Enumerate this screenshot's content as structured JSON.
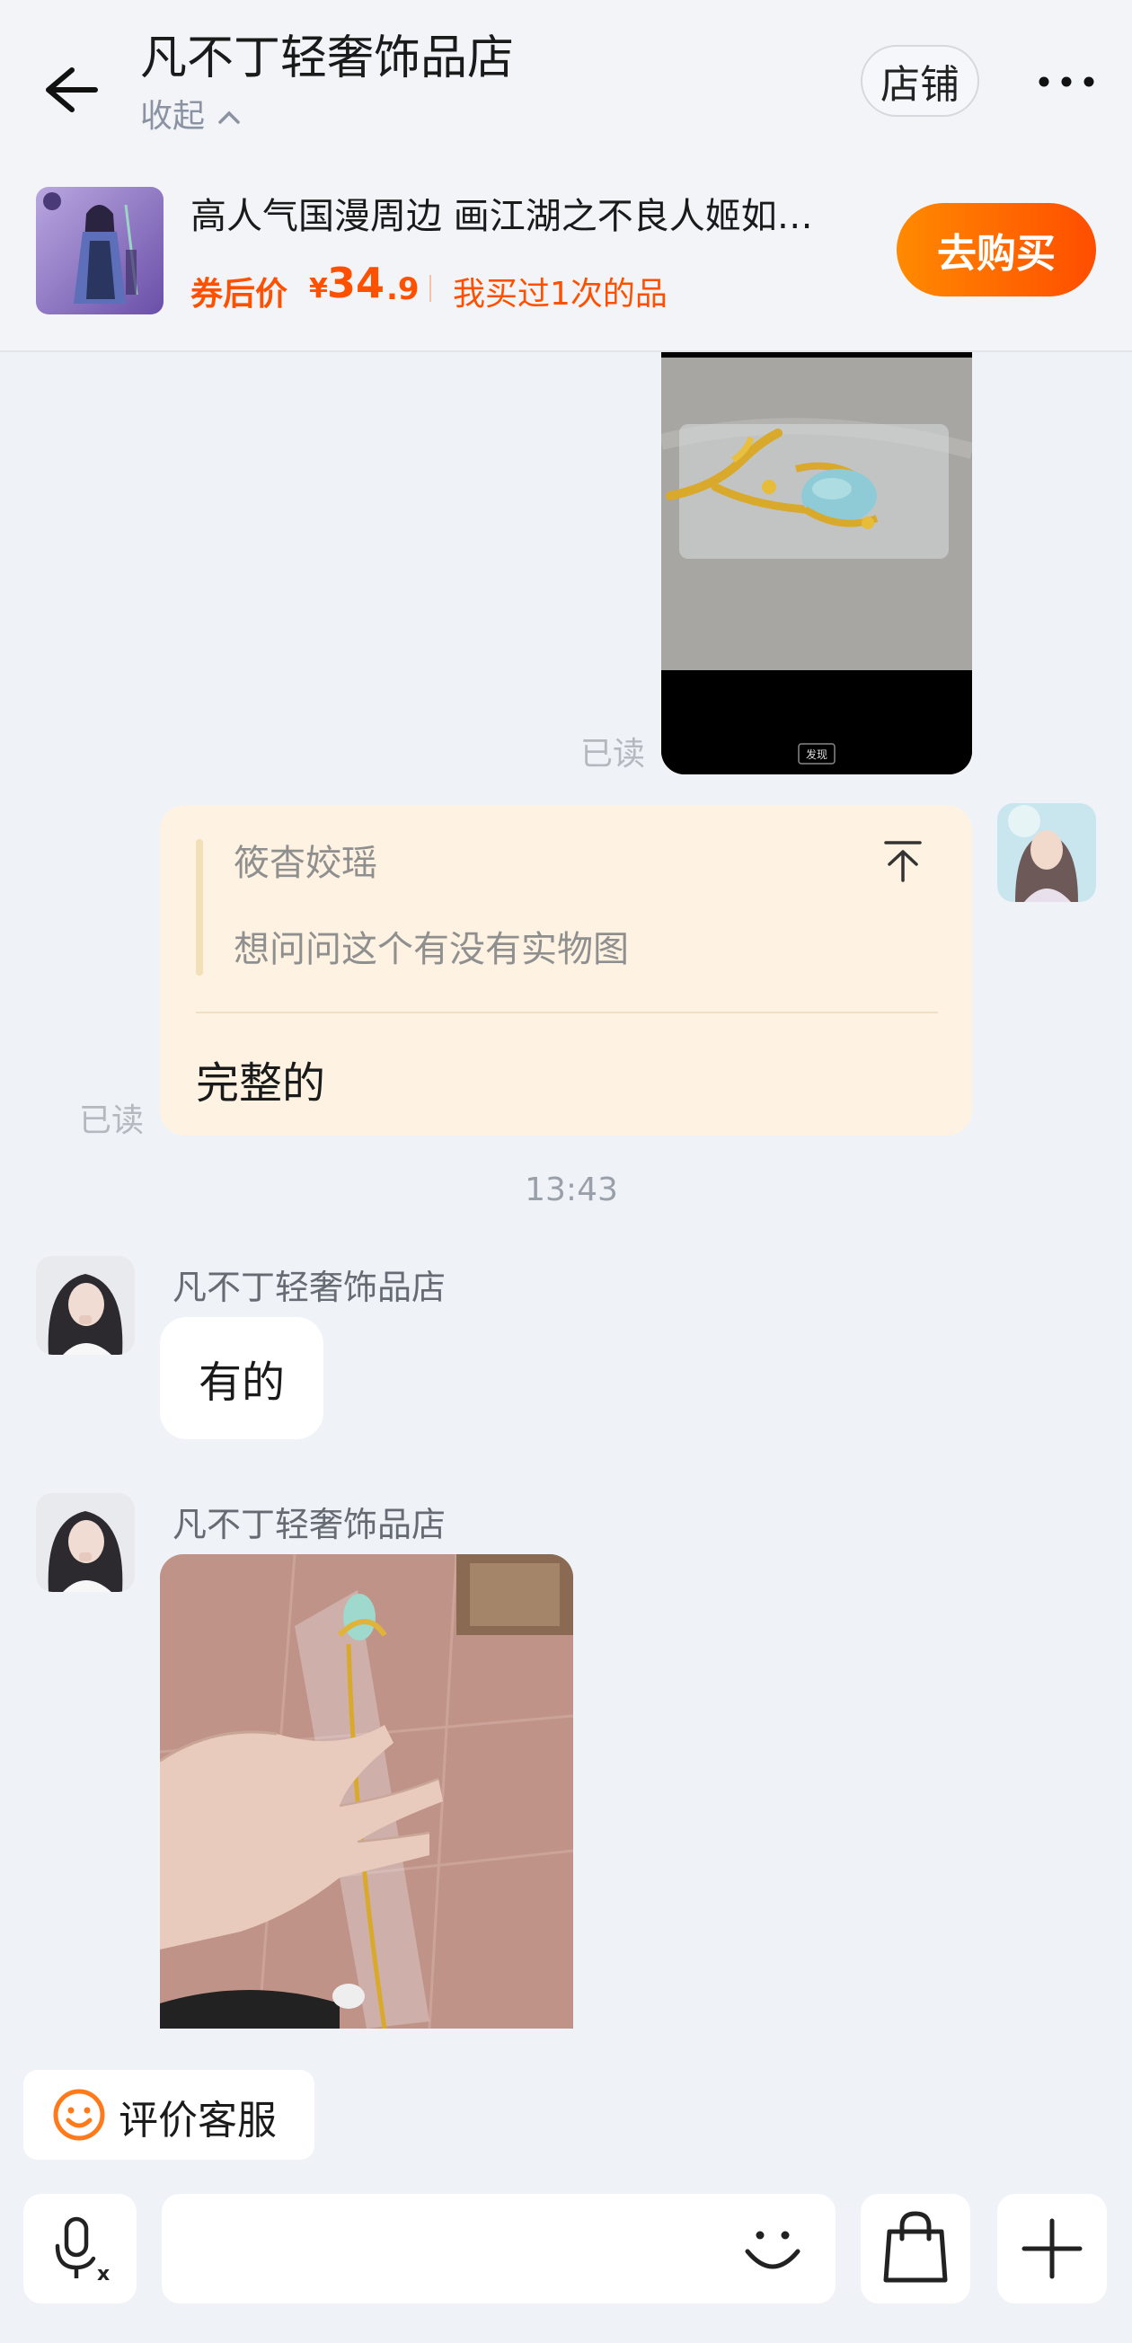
{
  "header": {
    "title": "凡不丁轻奢饰品店",
    "collapse_label": "收起",
    "shop_label": "店铺"
  },
  "product": {
    "title": "高人气国漫周边 画江湖之不良人姬如…",
    "price_label": "券后价",
    "currency": "¥",
    "price_int": "34",
    "price_dec": ".9",
    "bought_note": "我买过1次的品",
    "buy_label": "去购买"
  },
  "chat": {
    "read_label_1": "已读",
    "image_caption": "发现",
    "quote_name": "筱杳姣瑶",
    "quote_text": "想问问这个有没有实物图",
    "quote_reply": "完整的",
    "read_label_2": "已读",
    "timestamp": "13:43",
    "sender_1": "凡不丁轻奢饰品店",
    "reply_text": "有的",
    "sender_2": "凡不丁轻奢饰品店"
  },
  "bottom": {
    "rate_label": "评价客服",
    "input_placeholder": ""
  },
  "colors": {
    "accent": "#ff5000",
    "buy_gradient_start": "#ff8a00",
    "buy_gradient_end": "#ff4d00",
    "quote_bg": "#fef3e2",
    "page_bg": "#eff2f7"
  },
  "icons": {
    "back": "arrow-left-icon",
    "more": "more-dots-icon",
    "quote_top": "arrow-up-to-top-icon",
    "rate": "smile-face-icon",
    "voice": "mic-translate-icon",
    "emoji": "emoji-face-icon",
    "bag": "shopping-bag-icon",
    "plus": "plus-icon"
  }
}
